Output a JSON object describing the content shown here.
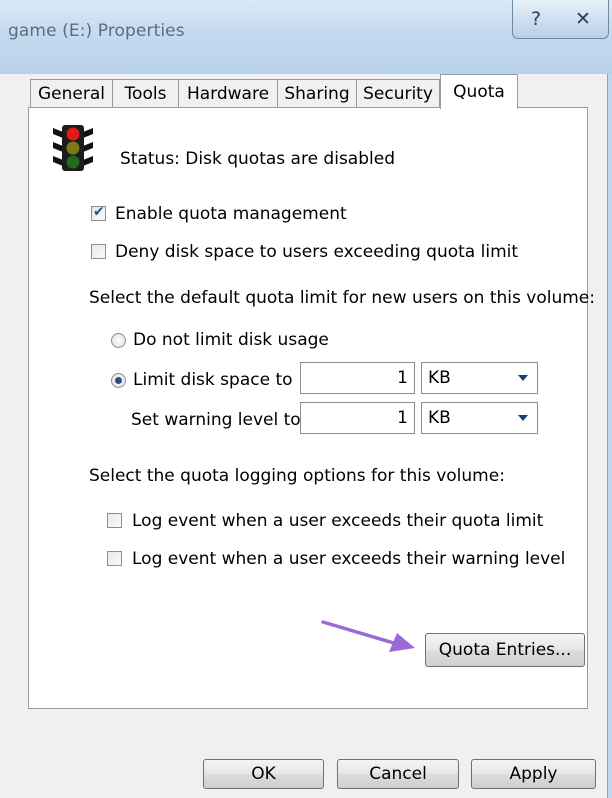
{
  "window": {
    "title": "game (E:) Properties",
    "help_glyph": "?",
    "close_glyph": "✕"
  },
  "tabs": [
    "General",
    "Tools",
    "Hardware",
    "Sharing",
    "Security",
    "Quota"
  ],
  "active_tab": "Quota",
  "status": {
    "text": "Status:  Disk quotas are disabled"
  },
  "options": {
    "enable_quota": {
      "label": "Enable quota management",
      "checked": true
    },
    "deny_space": {
      "label": "Deny disk space to users exceeding quota limit",
      "checked": false
    }
  },
  "default_limit": {
    "heading": "Select the default quota limit for new users on this volume:",
    "no_limit_label": "Do not limit disk usage",
    "limit_label": "Limit disk space to",
    "limit_value": "1",
    "limit_unit": "KB",
    "warning_label": "Set warning level to",
    "warning_value": "1",
    "warning_unit": "KB",
    "selected": "limit"
  },
  "logging": {
    "heading": "Select the quota logging options for this volume:",
    "log_limit_label": "Log event when a user exceeds their quota limit",
    "log_warning_label": "Log event when a user exceeds their warning level"
  },
  "buttons": {
    "quota_entries": "Quota Entries...",
    "ok": "OK",
    "cancel": "Cancel",
    "apply": "Apply"
  },
  "annotation_color": "#9b6ad6"
}
